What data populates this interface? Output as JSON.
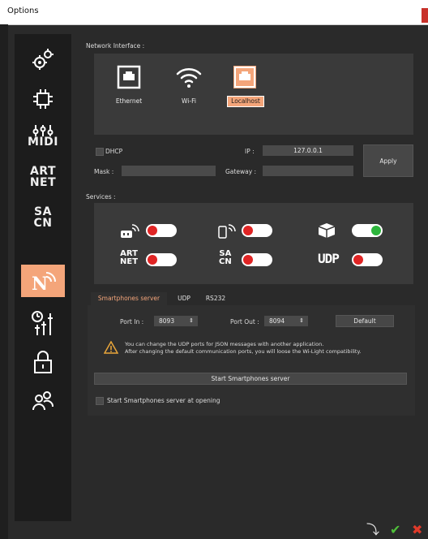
{
  "window": {
    "title": "Options"
  },
  "sidebar": {
    "items": [
      {
        "name": "settings",
        "text": ""
      },
      {
        "name": "hardware",
        "text": ""
      },
      {
        "name": "midi",
        "text": "MIDI"
      },
      {
        "name": "artnet",
        "line1": "ART",
        "line2": "NET"
      },
      {
        "name": "sacn",
        "line1": "SA",
        "line2": "CN"
      },
      {
        "name": "network",
        "text": "N"
      },
      {
        "name": "timers",
        "text": ""
      },
      {
        "name": "lock",
        "text": ""
      },
      {
        "name": "users",
        "text": ""
      }
    ]
  },
  "network": {
    "section_label": "Network Interface :",
    "interfaces": [
      {
        "label": "Ethernet",
        "selected": false
      },
      {
        "label": "Wi-Fi",
        "selected": false
      },
      {
        "label": "Localhost",
        "selected": true
      }
    ],
    "dhcp_label": "DHCP",
    "ip_label": "IP :",
    "ip_value": "127.0.0.1",
    "mask_label": "Mask :",
    "mask_value": "",
    "gateway_label": "Gateway :",
    "gateway_value": "",
    "apply_label": "Apply"
  },
  "services": {
    "section_label": "Services :",
    "items": [
      {
        "name": "wifi-light",
        "state": "off"
      },
      {
        "name": "smartphone",
        "state": "off"
      },
      {
        "name": "box",
        "state": "on"
      },
      {
        "name": "artnet",
        "line1": "ART",
        "line2": "NET",
        "state": "off"
      },
      {
        "name": "sacn",
        "line1": "SA",
        "line2": "CN",
        "state": "off"
      },
      {
        "name": "udp",
        "text": "UDP",
        "state": "off"
      }
    ]
  },
  "tabs": [
    "Smartphones server",
    "UDP",
    "RS232"
  ],
  "smartphones": {
    "port_in_label": "Port In :",
    "port_in_value": "8093",
    "port_out_label": "Port Out :",
    "port_out_value": "8094",
    "default_label": "Default",
    "warning_line1": "You can change the UDP ports for JSON messages with another application.",
    "warning_line2": "After changing the default communication ports, you will loose the Wi-Light compatibility.",
    "start_button_label": "Start Smartphones server",
    "start_at_opening_label": "Start Smartphones server at opening"
  },
  "colors": {
    "accent": "#f4a57a",
    "toggle_off": "#e02424",
    "toggle_on": "#2db53c",
    "confirm": "#4fbf3a",
    "cancel": "#e03a2a"
  }
}
